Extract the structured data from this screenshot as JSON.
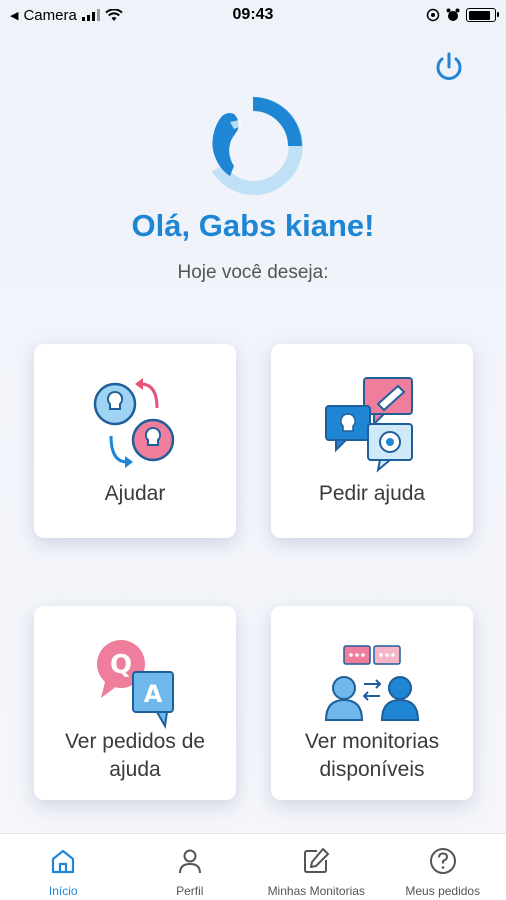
{
  "status_bar": {
    "back_app": "Camera",
    "time": "09:43",
    "battery_level": 0.85
  },
  "header": {
    "greeting": "Olá, Gabs kiane!",
    "subtitle": "Hoje você deseja:"
  },
  "cards": [
    {
      "id": "ajudar",
      "label": "Ajudar",
      "icon": "exchange-ideas-icon"
    },
    {
      "id": "pedir-ajuda",
      "label": "Pedir ajuda",
      "icon": "chat-bubbles-icon"
    },
    {
      "id": "ver-pedidos",
      "label": "Ver pedidos de ajuda",
      "icon": "question-answer-icon"
    },
    {
      "id": "ver-monitorias",
      "label": "Ver monitorias disponíveis",
      "icon": "people-chat-icon"
    }
  ],
  "tab_bar": {
    "items": [
      {
        "label": "Início",
        "icon": "home-icon",
        "active": true
      },
      {
        "label": "Perfil",
        "icon": "user-icon",
        "active": false
      },
      {
        "label": "Minhas Monitorias",
        "icon": "edit-icon",
        "active": false
      },
      {
        "label": "Meus pedidos",
        "icon": "help-circle-icon",
        "active": false
      }
    ]
  },
  "colors": {
    "accent": "#1f86d6",
    "pink": "#e8537a",
    "light_blue": "#9ed3f3"
  }
}
